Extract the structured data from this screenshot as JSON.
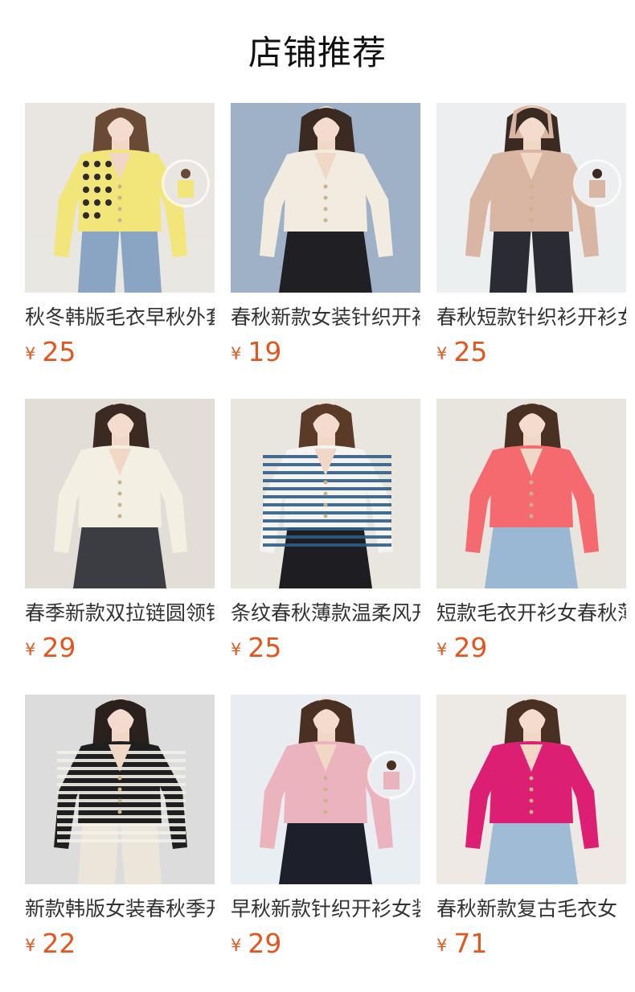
{
  "header": {
    "title": "店铺推荐"
  },
  "currency_symbol": "¥",
  "products": [
    {
      "name": "秋冬韩版毛衣早秋外套",
      "price": "25",
      "image": {
        "background": "#e9e6e2",
        "garment": "#f2e57a",
        "bottom": "#8aa5c4",
        "hair": "#6b4a35",
        "style": "cardigan-pattern",
        "inset": true
      }
    },
    {
      "name": "春秋新款女装针织开衫",
      "price": "19",
      "image": {
        "background": "#9fb1c7",
        "garment": "#f1ebe0",
        "bottom": "#1f1f24",
        "hair": "#3a2a22",
        "style": "cardigan-plain",
        "inset": false
      }
    },
    {
      "name": "春秋短款针织衫开衫女",
      "price": "25",
      "image": {
        "background": "#eceef0",
        "garment": "#d9b6a3",
        "bottom": "#2b2b33",
        "hair": "#3a2a22",
        "style": "hoodie",
        "inset": true
      }
    },
    {
      "name": "春季新款双拉链圆领针织",
      "price": "29",
      "image": {
        "background": "#e2ddd6",
        "garment": "#f3efe3",
        "bottom": "#3b3d42",
        "hair": "#3a2a22",
        "style": "cardigan-plain",
        "inset": false
      }
    },
    {
      "name": "条纹春秋薄款温柔风开衫",
      "price": "25",
      "image": {
        "background": "#e9e5df",
        "garment": "#f4f4f2",
        "bottom": "#1d1d22",
        "hair": "#5b3a28",
        "style": "stripe-blue",
        "inset": false
      }
    },
    {
      "name": "短款毛衣开衫女春秋薄款",
      "price": "29",
      "image": {
        "background": "#e8e4de",
        "garment": "#f56a6e",
        "bottom": "#9ab7d3",
        "hair": "#4a3022",
        "style": "cardigan-plain",
        "inset": false
      }
    },
    {
      "name": "新款韩版女装春秋季开衫",
      "price": "22",
      "image": {
        "background": "#dcdcdc",
        "garment": "#1f1f1f",
        "bottom": "#ece6da",
        "hair": "#2a211c",
        "style": "stripe-bw",
        "inset": false
      }
    },
    {
      "name": "早秋新款针织开衫女装外",
      "price": "29",
      "image": {
        "background": "#e9edf2",
        "garment": "#eab3bd",
        "bottom": "#1d1f2a",
        "hair": "#4a3022",
        "style": "cardigan-plain",
        "inset": true
      }
    },
    {
      "name": "春秋新款复古毛衣女",
      "price": "71",
      "image": {
        "background": "#ede9e4",
        "garment": "#dc1f73",
        "bottom": "#9fbbd6",
        "hair": "#4a3022",
        "style": "cardigan-plain",
        "inset": false
      }
    }
  ]
}
